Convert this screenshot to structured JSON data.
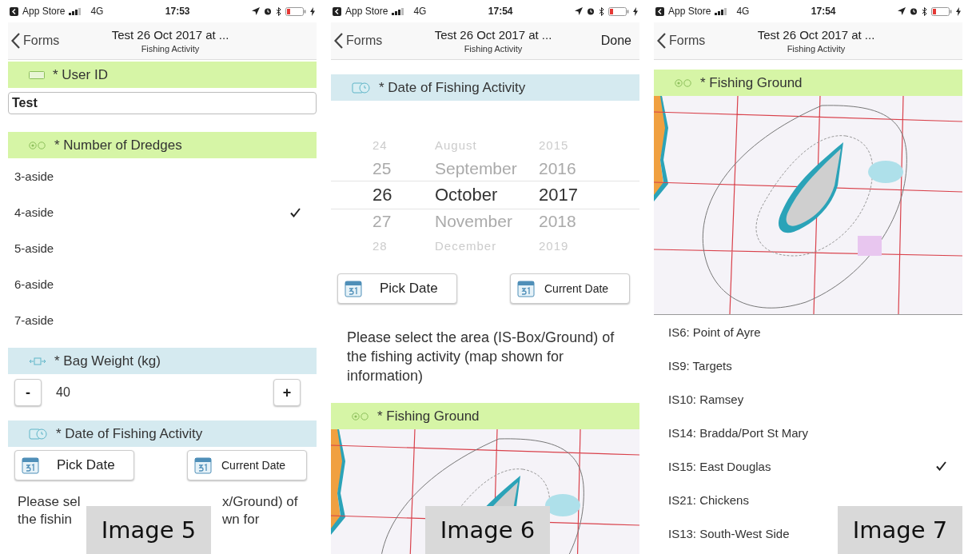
{
  "screens": [
    {
      "status_bar": {
        "carrier": "App Store",
        "network": "4G",
        "time": "17:53"
      },
      "nav": {
        "back": "Forms",
        "title": "Test 26 Oct 2017 at ...",
        "subtitle": "Fishing Activity"
      },
      "caption": "Image 5",
      "sections": [
        {
          "kind": "text_header",
          "label": "* User ID"
        },
        {
          "kind": "text_input",
          "value": "Test"
        },
        {
          "kind": "choice_header",
          "label": "* Number of Dredges"
        },
        {
          "kind": "options",
          "items": [
            {
              "label": "3-aside",
              "checked": false
            },
            {
              "label": "4-aside",
              "checked": true
            },
            {
              "label": "5-aside",
              "checked": false
            },
            {
              "label": "6-aside",
              "checked": false
            },
            {
              "label": "7-aside",
              "checked": false
            }
          ]
        },
        {
          "kind": "number_header",
          "label": "* Bag Weight (kg)"
        },
        {
          "kind": "stepper",
          "minus": "-",
          "value": "40",
          "plus": "+"
        },
        {
          "kind": "date_header",
          "label": "* Date of Fishing Activity"
        },
        {
          "kind": "date_buttons",
          "buttons": [
            "Pick Date",
            "Current Date"
          ]
        },
        {
          "kind": "covered_paragraph",
          "lines": [
            {
              "left": "Please sel",
              "right": "x/Ground) of"
            },
            {
              "left": "the fishin",
              "right": "wn for"
            }
          ]
        }
      ]
    },
    {
      "status_bar": {
        "carrier": "App Store",
        "network": "4G",
        "time": "17:54"
      },
      "nav": {
        "back": "Forms",
        "title": "Test 26 Oct 2017 at ...",
        "subtitle": "Fishing Activity",
        "action": "Done"
      },
      "caption": "Image 6",
      "sections": [
        {
          "kind": "date_header",
          "label": "* Date of Fishing Activity"
        },
        {
          "kind": "picker",
          "rows": [
            {
              "day": "24",
              "month": "August",
              "year": "2015",
              "selected": false
            },
            {
              "day": "25",
              "month": "September",
              "year": "2016",
              "selected": false
            },
            {
              "day": "26",
              "month": "October",
              "year": "2017",
              "selected": true
            },
            {
              "day": "27",
              "month": "November",
              "year": "2018",
              "selected": false
            },
            {
              "day": "28",
              "month": "December",
              "year": "2019",
              "selected": false
            }
          ]
        },
        {
          "kind": "date_buttons",
          "buttons": [
            "Pick Date",
            "Current Date"
          ]
        },
        {
          "kind": "paragraph",
          "text": "Please select the area (IS-Box/Ground) of the fishing activity (map shown for information)"
        },
        {
          "kind": "choice_header",
          "label": "* Fishing Ground"
        },
        {
          "kind": "map"
        }
      ]
    },
    {
      "status_bar": {
        "carrier": "App Store",
        "network": "4G",
        "time": "17:54"
      },
      "nav": {
        "back": "Forms",
        "title": "Test 26 Oct 2017 at ...",
        "subtitle": "Fishing Activity"
      },
      "caption": "Image 7",
      "sections": [
        {
          "kind": "choice_header",
          "label": "* Fishing Ground"
        },
        {
          "kind": "map"
        },
        {
          "kind": "options",
          "items": [
            {
              "label": "IS6: Point of Ayre",
              "checked": false
            },
            {
              "label": "IS9: Targets",
              "checked": false
            },
            {
              "label": "IS10: Ramsey",
              "checked": false
            },
            {
              "label": "IS14: Bradda/Port St Mary",
              "checked": false
            },
            {
              "label": "IS15: East Douglas",
              "checked": true
            },
            {
              "label": "IS21: Chickens",
              "checked": false
            },
            {
              "label": "IS13: South-West Side"
            }
          ]
        }
      ]
    }
  ]
}
